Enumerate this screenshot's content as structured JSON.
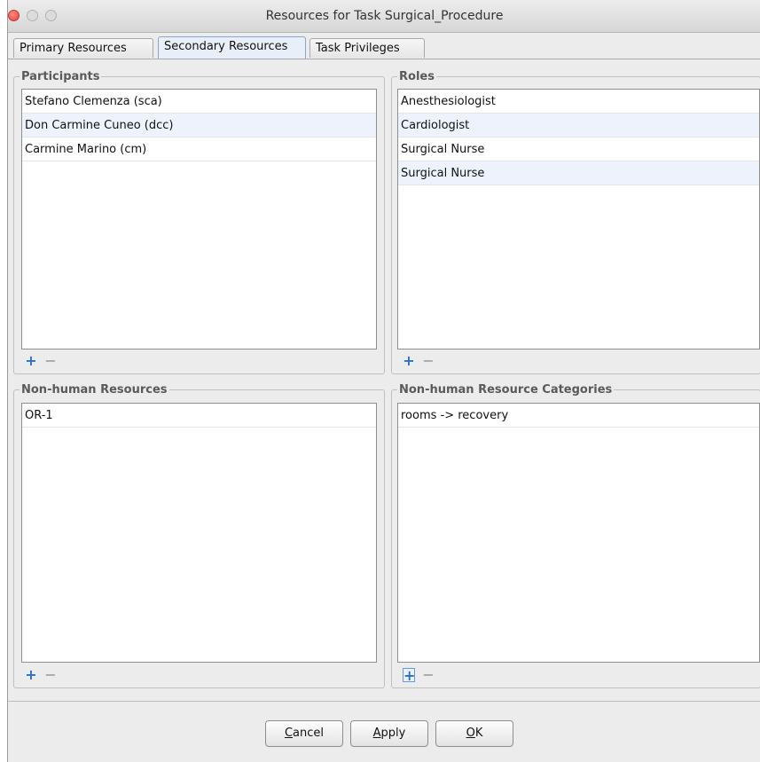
{
  "window": {
    "title": "Resources for Task Surgical_Procedure"
  },
  "tabs": [
    {
      "label": "Primary Resources",
      "active": false
    },
    {
      "label": "Secondary Resources",
      "active": true
    },
    {
      "label": "Task Privileges",
      "active": false
    }
  ],
  "participants": {
    "title": "Participants",
    "items": [
      "Stefano Clemenza (sca)",
      "Don Carmine Cuneo (dcc)",
      "Carmine Marino (cm)"
    ]
  },
  "roles": {
    "title": "Roles",
    "items": [
      "Anesthesiologist",
      "Cardiologist",
      "Surgical Nurse",
      "Surgical Nurse"
    ]
  },
  "nonhuman_resources": {
    "title": "Non-human Resources",
    "items": [
      "OR-1"
    ]
  },
  "nonhuman_categories": {
    "title": "Non-human Resource Categories",
    "items": [
      "rooms -> recovery"
    ]
  },
  "controls": {
    "add": "+",
    "remove": "−"
  },
  "buttons": {
    "cancel_mnemonic": "C",
    "cancel_rest": "ancel",
    "apply_mnemonic": "A",
    "apply_rest": "pply",
    "ok_mnemonic": "O",
    "ok_rest": "K"
  },
  "colors": {
    "accent": "#2d6fbf",
    "row_alt": "#edf2fc",
    "window_bg": "#ececec"
  }
}
